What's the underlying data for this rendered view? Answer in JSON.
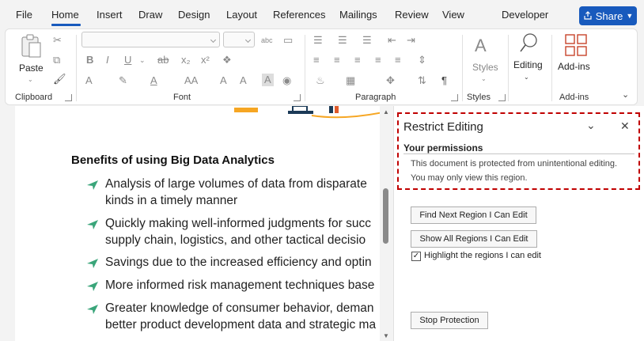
{
  "menu": {
    "tabs": [
      "File",
      "Home",
      "Insert",
      "Draw",
      "Design",
      "Layout",
      "References",
      "Mailings",
      "Review",
      "View",
      "Developer"
    ],
    "share_label": "Share"
  },
  "ribbon": {
    "clipboard_label": "Clipboard",
    "paste_label": "Paste",
    "font_label": "Font",
    "paragraph_label": "Paragraph",
    "styles_label": "Styles",
    "styles_big_label": "Styles",
    "editing_label": "Editing",
    "addins_label": "Add-ins",
    "addins_group_label": "Add-ins"
  },
  "document": {
    "heading": "Benefits of using Big Data Analytics",
    "lines": [
      "Analysis of large volumes of data from disparate",
      "kinds in a timely manner",
      "Quickly making well-informed judgments for succ",
      "supply chain, logistics, and other tactical decisio",
      "Savings due to the increased efficiency and optin",
      "More informed risk management techniques base",
      "Greater knowledge of consumer behavior, deman",
      "better product development data and strategic ma"
    ],
    "bullet_color": "#3aa57a"
  },
  "pane": {
    "title": "Restrict Editing",
    "permissions_heading": "Your permissions",
    "perm_line1": "This document is protected from unintentional editing.",
    "perm_line2": "You may only view this region.",
    "find_next_label": "Find Next Region I Can Edit",
    "show_all_label": "Show All Regions I Can Edit",
    "highlight_label": "Highlight the regions I can edit",
    "highlight_checked": true,
    "stop_label": "Stop Protection"
  }
}
